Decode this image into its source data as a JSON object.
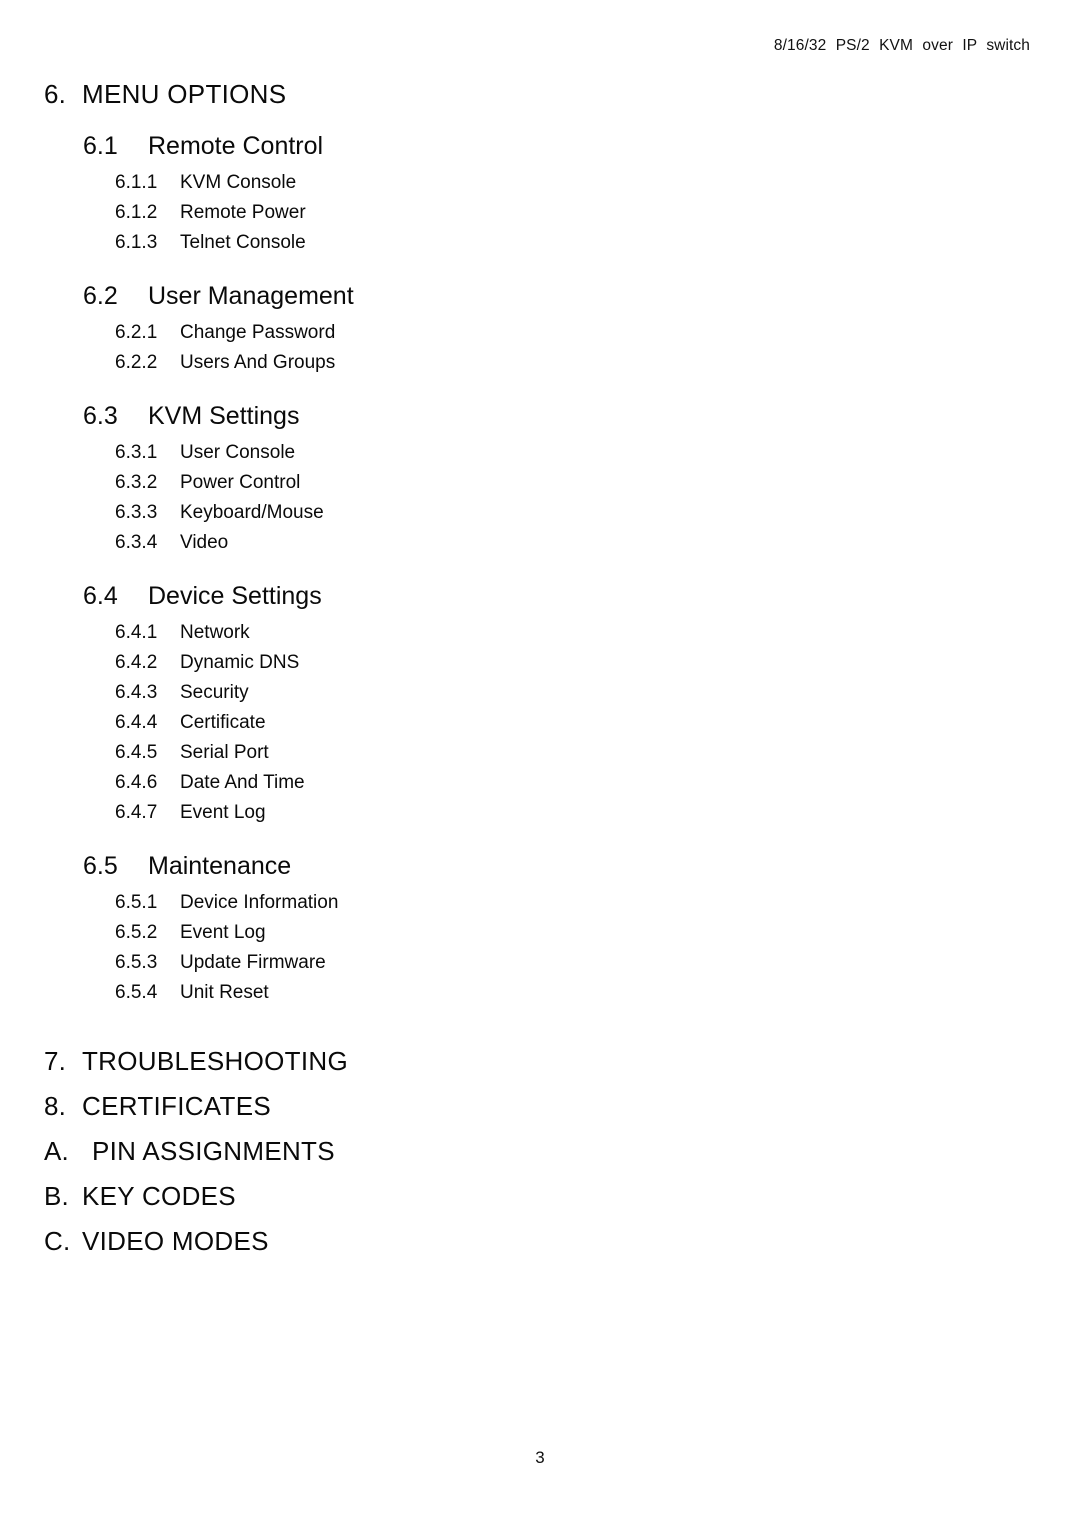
{
  "header": {
    "running_title": "8/16/32 PS/2 KVM over IP switch"
  },
  "footer": {
    "page_number": "3"
  },
  "toc": {
    "sections": [
      {
        "level": 1,
        "number": "6.",
        "title": "MENU OPTIONS"
      },
      {
        "level": 2,
        "number": "6.1",
        "title": "Remote Control"
      },
      {
        "level": 3,
        "number": "6.1.1",
        "title": "KVM Console"
      },
      {
        "level": 3,
        "number": "6.1.2",
        "title": "Remote Power"
      },
      {
        "level": 3,
        "number": "6.1.3",
        "title": "Telnet Console"
      },
      {
        "level": 2,
        "number": "6.2",
        "title": "User Management"
      },
      {
        "level": 3,
        "number": "6.2.1",
        "title": "Change Password"
      },
      {
        "level": 3,
        "number": "6.2.2",
        "title": "Users And Groups"
      },
      {
        "level": 2,
        "number": "6.3",
        "title": "KVM Settings"
      },
      {
        "level": 3,
        "number": "6.3.1",
        "title": "User Console"
      },
      {
        "level": 3,
        "number": "6.3.2",
        "title": "Power Control"
      },
      {
        "level": 3,
        "number": "6.3.3",
        "title": "Keyboard/Mouse"
      },
      {
        "level": 3,
        "number": "6.3.4",
        "title": "Video"
      },
      {
        "level": 2,
        "number": "6.4",
        "title": "Device Settings"
      },
      {
        "level": 3,
        "number": "6.4.1",
        "title": "Network"
      },
      {
        "level": 3,
        "number": "6.4.2",
        "title": "Dynamic DNS"
      },
      {
        "level": 3,
        "number": "6.4.3",
        "title": "Security"
      },
      {
        "level": 3,
        "number": "6.4.4",
        "title": "Certificate"
      },
      {
        "level": 3,
        "number": "6.4.5",
        "title": "Serial Port"
      },
      {
        "level": 3,
        "number": "6.4.6",
        "title": "Date And Time"
      },
      {
        "level": 3,
        "number": "6.4.7",
        "title": "Event Log"
      },
      {
        "level": 2,
        "number": "6.5",
        "title": "Maintenance"
      },
      {
        "level": 3,
        "number": "6.5.1",
        "title": "Device Information"
      },
      {
        "level": 3,
        "number": "6.5.2",
        "title": "Event Log"
      },
      {
        "level": 3,
        "number": "6.5.3",
        "title": "Update Firmware"
      },
      {
        "level": 3,
        "number": "6.5.4",
        "title": "Unit Reset"
      },
      {
        "level": 1,
        "number": "7.",
        "title": "TROUBLESHOOTING"
      },
      {
        "level": 1,
        "number": "8.",
        "title": "CERTIFICATES"
      },
      {
        "level": 1,
        "number": "A.",
        "title": "PIN ASSIGNMENTS",
        "wide_number_column": true
      },
      {
        "level": 1,
        "number": "B.",
        "title": "KEY CODES"
      },
      {
        "level": 1,
        "number": "C.",
        "title": "VIDEO MODES"
      }
    ]
  }
}
